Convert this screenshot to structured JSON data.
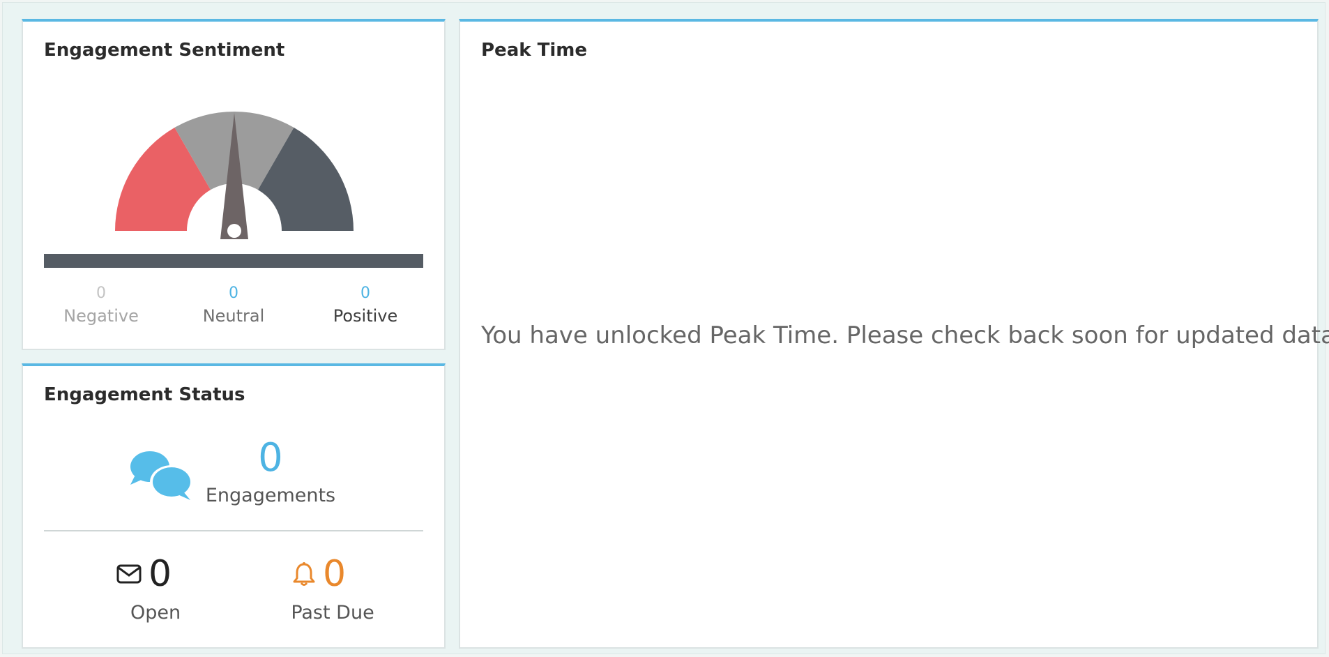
{
  "colors": {
    "accent": "#5ab8e3",
    "negative": "#ea6165",
    "neutral": "#9c9c9c",
    "positive": "#565d65",
    "needle": "#6d6465",
    "past_due": "#e9882c"
  },
  "sentiment": {
    "title": "Engagement Sentiment",
    "gauge_value": 0.5,
    "negative": {
      "count": "0",
      "label": "Negative"
    },
    "neutral": {
      "count": "0",
      "label": "Neutral"
    },
    "positive": {
      "count": "0",
      "label": "Positive"
    }
  },
  "status": {
    "title": "Engagement Status",
    "engagements": {
      "count": "0",
      "label": "Engagements",
      "icon": "chat-bubbles-icon"
    },
    "open": {
      "count": "0",
      "label": "Open",
      "icon": "envelope-icon"
    },
    "past_due": {
      "count": "0",
      "label": "Past Due",
      "icon": "bell-icon"
    }
  },
  "peak": {
    "title": "Peak Time",
    "message": "You have unlocked Peak Time. Please check back soon for updated data."
  }
}
